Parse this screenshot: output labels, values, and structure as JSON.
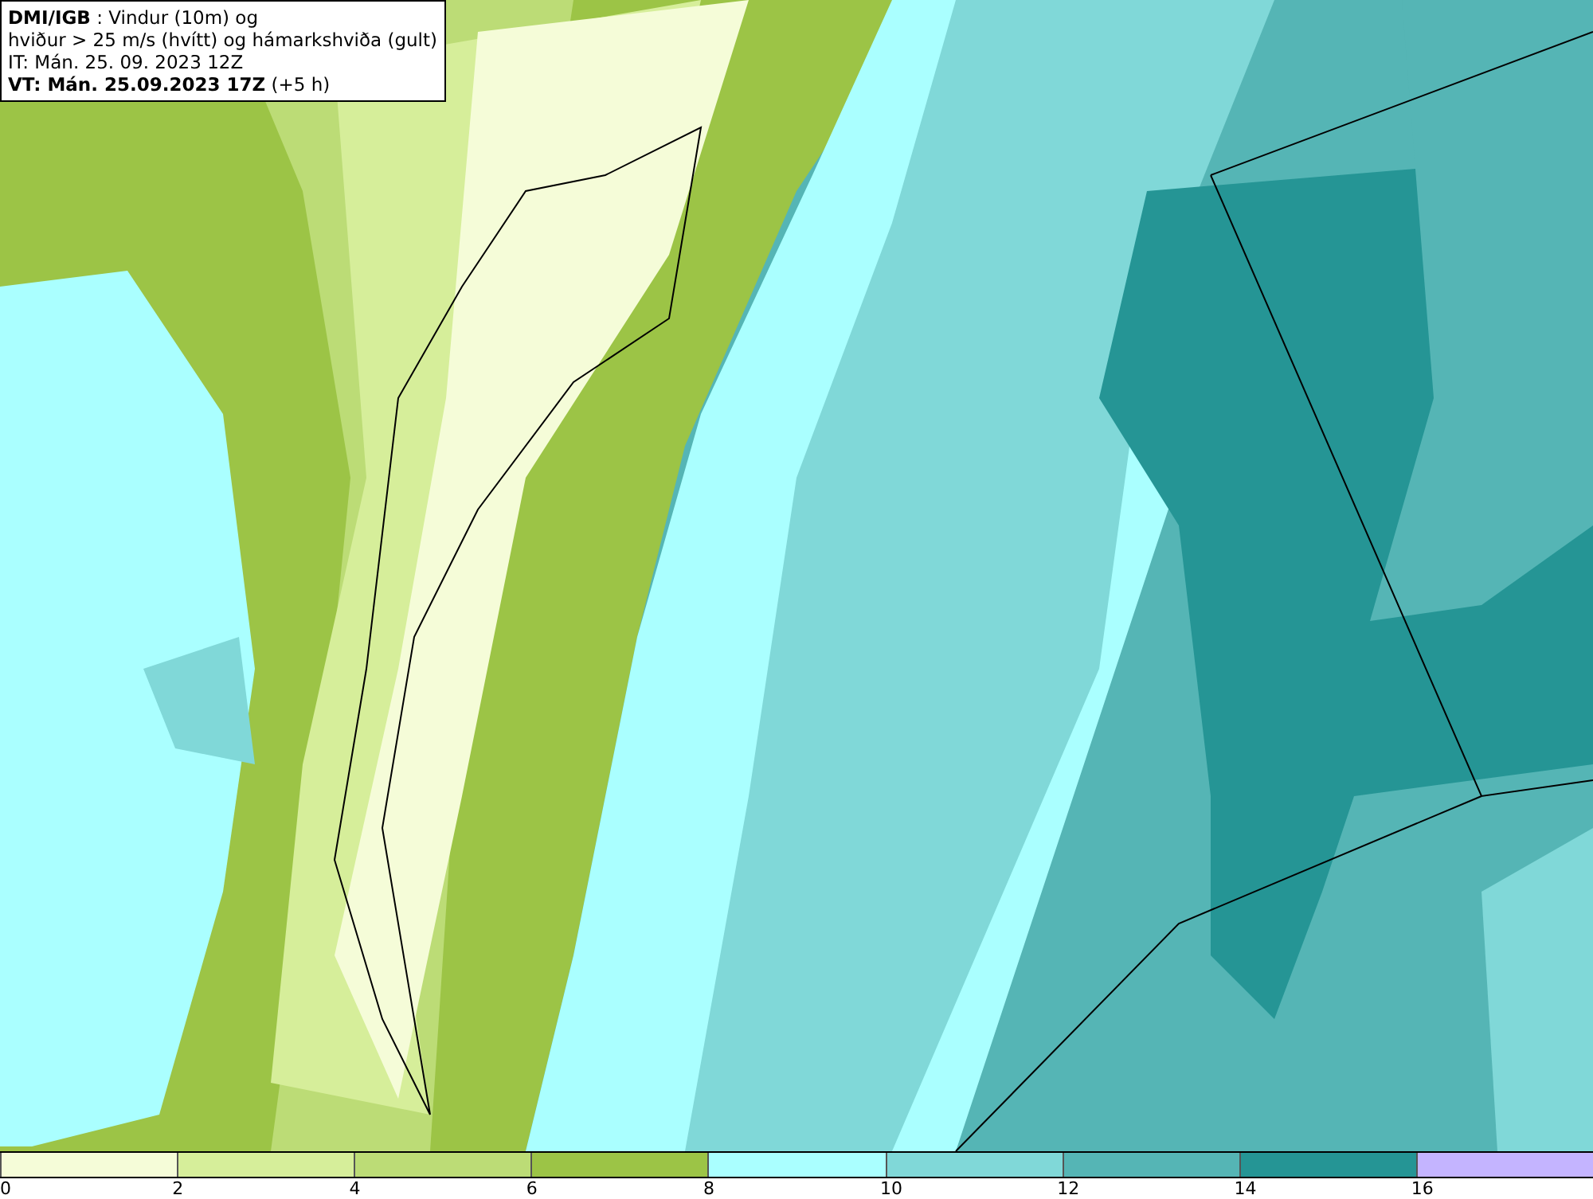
{
  "info_box": {
    "lines": [
      "**DMI/IGB** : Vindur (10m) og",
      "hviður > 25 m/s (hvítt) og hámarkshviða (gult)",
      "IT: Mán. 25. 09. 2023 12Z",
      "**VT: Mán. 25.09.2023 17Z** (+5 h)"
    ]
  },
  "legend": {
    "bins": [
      {
        "label": "0",
        "color": "#f5fcd8"
      },
      {
        "label": "2",
        "color": "#d6ee9a"
      },
      {
        "label": "4",
        "color": "#bcdc76"
      },
      {
        "label": "6",
        "color": "#9cc446"
      },
      {
        "label": "8",
        "color": "#aaffff"
      },
      {
        "label": "10",
        "color": "#80d8d8"
      },
      {
        "label": "12",
        "color": "#55b5b5"
      },
      {
        "label": "14",
        "color": "#259595"
      },
      {
        "label": "16",
        "color": "#c4b4ff"
      }
    ]
  }
}
